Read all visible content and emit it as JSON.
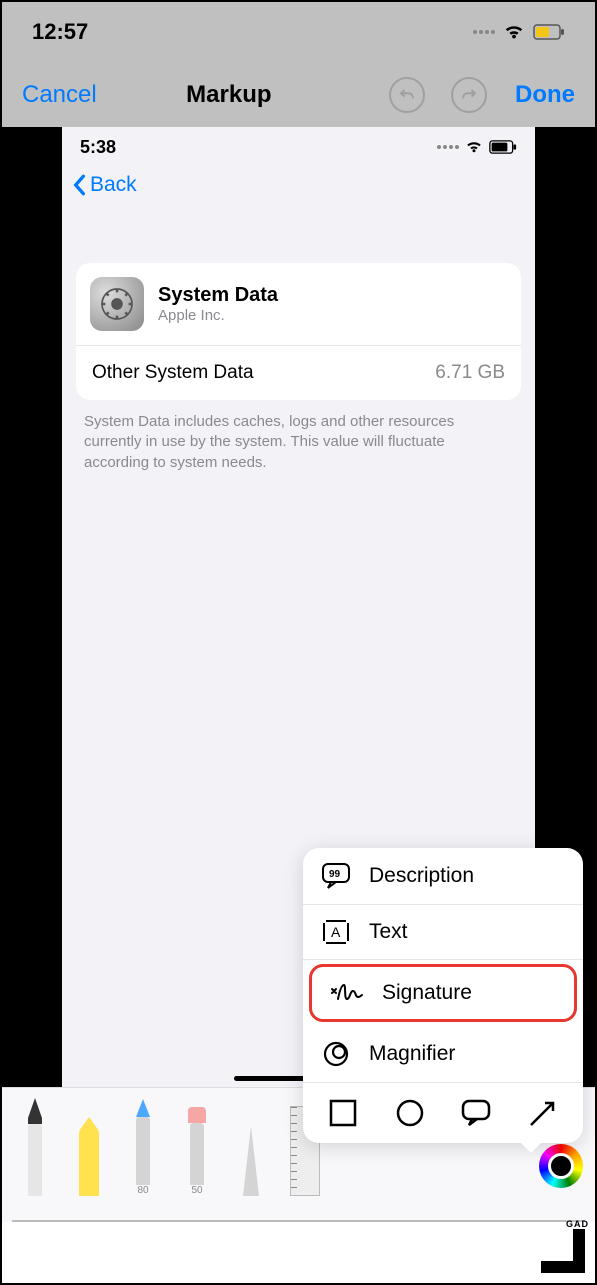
{
  "outer_status": {
    "time": "12:57"
  },
  "markup_header": {
    "cancel": "Cancel",
    "title": "Markup",
    "done": "Done"
  },
  "inner_status": {
    "time": "5:38"
  },
  "back_label": "Back",
  "card": {
    "title": "System Data",
    "subtitle": "Apple Inc.",
    "row_label": "Other System Data",
    "row_value": "6.71 GB"
  },
  "description": "System Data includes caches, logs and other resources currently in use by the system. This value will fluctuate according to system needs.",
  "popup": {
    "description": "Description",
    "text": "Text",
    "signature": "Signature",
    "magnifier": "Magnifier"
  },
  "tool_labels": {
    "pencil_num1": "80",
    "pencil_num2": "50"
  },
  "watermark": "GAD"
}
